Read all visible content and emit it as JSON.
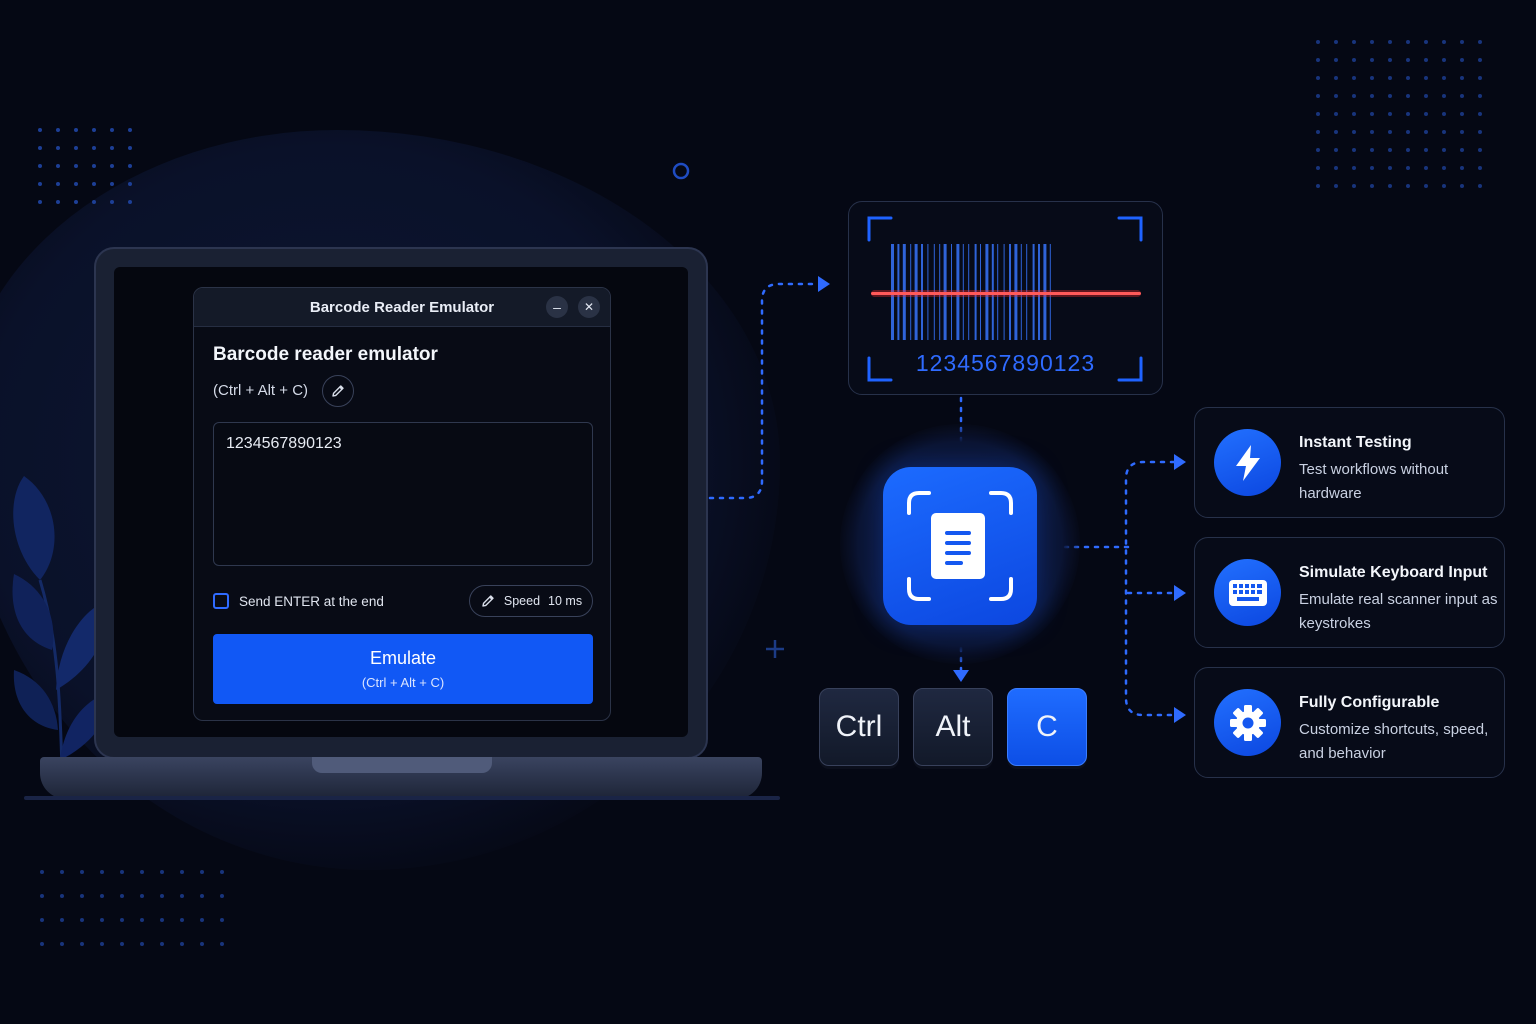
{
  "window": {
    "title": "Barcode Reader Emulator",
    "minimize_symbol": "–",
    "close_symbol": "✕",
    "heading": "Barcode reader emulator",
    "shortcut": "(Ctrl + Alt + C)",
    "textarea_value": "1234567890123",
    "send_enter_label": "Send ENTER at the end",
    "send_enter_checked": false,
    "speed_label": "Speed",
    "speed_value": "10 ms",
    "emulate_label": "Emulate",
    "emulate_shortcut": "(Ctrl + Alt + C)"
  },
  "scanner": {
    "barcode_number": "1234567890123"
  },
  "keys": [
    "Ctrl",
    "Alt",
    "C"
  ],
  "features": [
    {
      "title": "Instant Testing",
      "description": "Test workflows without hardware",
      "icon": "lightning-icon"
    },
    {
      "title": "Simulate Keyboard Input",
      "description": "Emulate real scanner input as keystrokes",
      "icon": "keyboard-icon"
    },
    {
      "title": "Fully Configurable",
      "description": "Customize shortcuts, speed, and behavior",
      "icon": "gear-icon"
    }
  ],
  "colors": {
    "background": "#050814",
    "accent": "#1158f5",
    "scan_line": "#ff3b3b"
  }
}
